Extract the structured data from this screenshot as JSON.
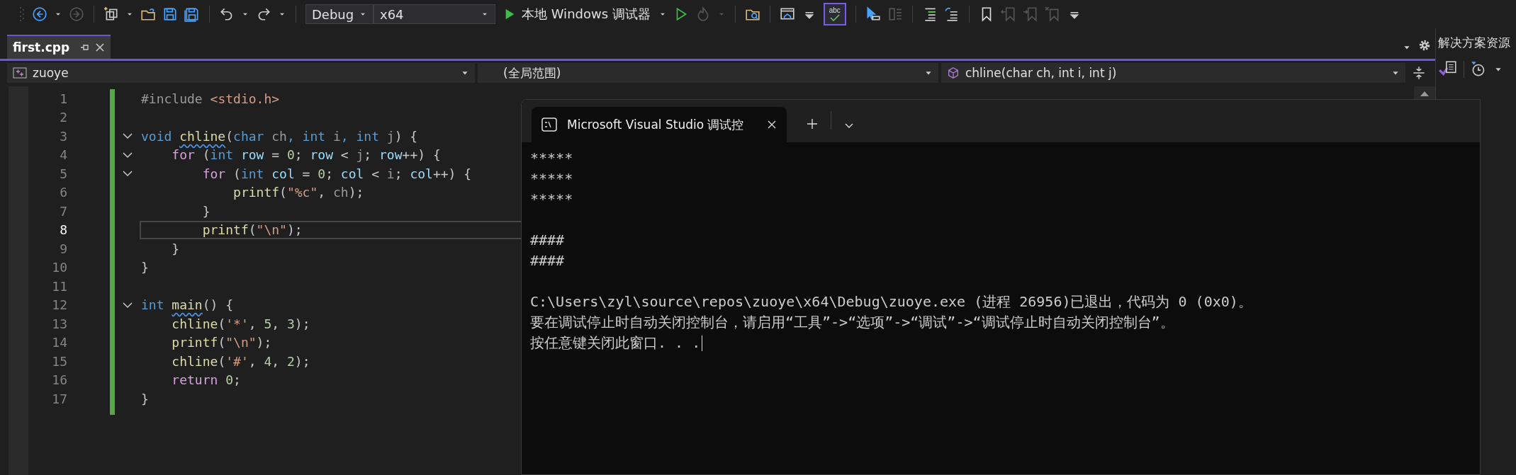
{
  "toolbar": {
    "items": [
      {
        "kind": "back",
        "disabled": false
      },
      {
        "kind": "caret",
        "disabled": false
      },
      {
        "kind": "forward",
        "disabled": true
      },
      {
        "kind": "sep"
      },
      {
        "kind": "new-item",
        "disabled": false
      },
      {
        "kind": "caret",
        "disabled": false
      },
      {
        "kind": "open",
        "disabled": false
      },
      {
        "kind": "save",
        "disabled": false
      },
      {
        "kind": "save-all",
        "disabled": false
      },
      {
        "kind": "sep"
      },
      {
        "kind": "undo",
        "disabled": false
      },
      {
        "kind": "caret",
        "disabled": false
      },
      {
        "kind": "redo",
        "disabled": false
      },
      {
        "kind": "caret",
        "disabled": false
      },
      {
        "kind": "sep"
      },
      {
        "kind": "config",
        "disabled": false,
        "value": "Debug"
      },
      {
        "kind": "platform",
        "disabled": false,
        "value": "x64"
      },
      {
        "kind": "run",
        "disabled": false,
        "label": "本地 Windows 调试器"
      },
      {
        "kind": "caret",
        "disabled": false
      },
      {
        "kind": "run-nodebug",
        "disabled": false
      },
      {
        "kind": "flame",
        "disabled": true
      },
      {
        "kind": "caret",
        "disabled": true
      },
      {
        "kind": "sep"
      },
      {
        "kind": "browse",
        "disabled": false
      },
      {
        "kind": "sep"
      },
      {
        "kind": "home-window",
        "disabled": false
      },
      {
        "kind": "overflow",
        "disabled": false
      },
      {
        "kind": "spell",
        "disabled": false,
        "label": "abc",
        "checked": true
      },
      {
        "kind": "sep"
      },
      {
        "kind": "pointer",
        "disabled": false
      },
      {
        "kind": "panes",
        "disabled": true
      },
      {
        "kind": "sep"
      },
      {
        "kind": "indent",
        "disabled": false
      },
      {
        "kind": "unindent",
        "disabled": false
      },
      {
        "kind": "sep"
      },
      {
        "kind": "bookmark",
        "disabled": false
      },
      {
        "kind": "bookmark-prev",
        "disabled": true
      },
      {
        "kind": "bookmark-next",
        "disabled": true
      },
      {
        "kind": "bookmark-clear",
        "disabled": true
      },
      {
        "kind": "overflow",
        "disabled": false
      }
    ]
  },
  "document_tab": {
    "label": "first.cpp",
    "selected": true
  },
  "nav_bar": {
    "project": "zuoye",
    "scope": "(全局范围)",
    "member": "chline(char ch, int i, int j)"
  },
  "editor": {
    "lines": [
      {
        "number": "1",
        "fold": false,
        "current": false,
        "tokens": [
          {
            "text": "#include",
            "kind": "pp"
          },
          {
            "text": " <stdio.h>",
            "kind": "inc"
          }
        ]
      },
      {
        "number": "2",
        "fold": false,
        "current": false
      },
      {
        "number": "3",
        "fold": true,
        "current": false,
        "tokens": [
          {
            "text": "void ",
            "kind": "kw"
          },
          {
            "text": "chline",
            "kind": "fn_warn"
          },
          {
            "text": "(",
            "kind": "p"
          },
          {
            "text": "char ",
            "kind": "kw"
          },
          {
            "text": "ch",
            "kind": "param"
          },
          {
            "text": ", int ",
            "kind": "kw"
          },
          {
            "text": "i",
            "kind": "param"
          },
          {
            "text": ", int ",
            "kind": "kw"
          },
          {
            "text": "j",
            "kind": "param"
          },
          {
            "text": ") {",
            "kind": "p"
          }
        ]
      },
      {
        "number": "4",
        "fold": true,
        "current": false,
        "tokens": [
          {
            "text": "    for",
            "kind": "ctl"
          },
          {
            "text": " (",
            "kind": "p"
          },
          {
            "text": "int ",
            "kind": "kw"
          },
          {
            "text": "row",
            "kind": "var"
          },
          {
            "text": " = ",
            "kind": "p"
          },
          {
            "text": "0",
            "kind": "num"
          },
          {
            "text": "; ",
            "kind": "p"
          },
          {
            "text": "row",
            "kind": "var"
          },
          {
            "text": " < ",
            "kind": "p"
          },
          {
            "text": "j",
            "kind": "param"
          },
          {
            "text": "; ",
            "kind": "p"
          },
          {
            "text": "row",
            "kind": "var"
          },
          {
            "text": "++) {",
            "kind": "p"
          }
        ]
      },
      {
        "number": "5",
        "fold": true,
        "current": false,
        "tokens": [
          {
            "text": "        for",
            "kind": "ctl"
          },
          {
            "text": " (",
            "kind": "p"
          },
          {
            "text": "int ",
            "kind": "kw"
          },
          {
            "text": "col",
            "kind": "var"
          },
          {
            "text": " = ",
            "kind": "p"
          },
          {
            "text": "0",
            "kind": "num"
          },
          {
            "text": "; ",
            "kind": "p"
          },
          {
            "text": "col",
            "kind": "var"
          },
          {
            "text": " < ",
            "kind": "p"
          },
          {
            "text": "i",
            "kind": "param"
          },
          {
            "text": "; ",
            "kind": "p"
          },
          {
            "text": "col",
            "kind": "var"
          },
          {
            "text": "++) {",
            "kind": "p"
          }
        ]
      },
      {
        "number": "6",
        "fold": false,
        "current": false,
        "tokens": [
          {
            "text": "            printf",
            "kind": "fn"
          },
          {
            "text": "(",
            "kind": "p"
          },
          {
            "text": "\"%c\"",
            "kind": "str"
          },
          {
            "text": ", ",
            "kind": "p"
          },
          {
            "text": "ch",
            "kind": "param"
          },
          {
            "text": ");",
            "kind": "p"
          }
        ]
      },
      {
        "number": "7",
        "fold": false,
        "current": false,
        "tokens": [
          {
            "text": "        }",
            "kind": "p"
          }
        ]
      },
      {
        "number": "8",
        "fold": false,
        "current": true,
        "tokens": [
          {
            "text": "        printf",
            "kind": "fn"
          },
          {
            "text": "(",
            "kind": "p"
          },
          {
            "text": "\"\\n\"",
            "kind": "str"
          },
          {
            "text": ");",
            "kind": "p"
          }
        ]
      },
      {
        "number": "9",
        "fold": false,
        "current": false,
        "tokens": [
          {
            "text": "    }",
            "kind": "p"
          }
        ]
      },
      {
        "number": "10",
        "fold": false,
        "current": false,
        "tokens": [
          {
            "text": "}",
            "kind": "p"
          }
        ]
      },
      {
        "number": "11",
        "fold": false,
        "current": false
      },
      {
        "number": "12",
        "fold": true,
        "current": false,
        "tokens": [
          {
            "text": "int ",
            "kind": "kw"
          },
          {
            "text": "main",
            "kind": "fn_warn"
          },
          {
            "text": "() {",
            "kind": "p"
          }
        ]
      },
      {
        "number": "13",
        "fold": false,
        "current": false,
        "tokens": [
          {
            "text": "    chline",
            "kind": "fn"
          },
          {
            "text": "(",
            "kind": "p"
          },
          {
            "text": "'*'",
            "kind": "str"
          },
          {
            "text": ", ",
            "kind": "p"
          },
          {
            "text": "5",
            "kind": "num"
          },
          {
            "text": ", ",
            "kind": "p"
          },
          {
            "text": "3",
            "kind": "num"
          },
          {
            "text": ");",
            "kind": "p"
          }
        ]
      },
      {
        "number": "14",
        "fold": false,
        "current": false,
        "tokens": [
          {
            "text": "    printf",
            "kind": "fn"
          },
          {
            "text": "(",
            "kind": "p"
          },
          {
            "text": "\"\\n\"",
            "kind": "str"
          },
          {
            "text": ");",
            "kind": "p"
          }
        ]
      },
      {
        "number": "15",
        "fold": false,
        "current": false,
        "tokens": [
          {
            "text": "    chline",
            "kind": "fn"
          },
          {
            "text": "(",
            "kind": "p"
          },
          {
            "text": "'#'",
            "kind": "str"
          },
          {
            "text": ", ",
            "kind": "p"
          },
          {
            "text": "4",
            "kind": "num"
          },
          {
            "text": ", ",
            "kind": "p"
          },
          {
            "text": "2",
            "kind": "num"
          },
          {
            "text": ");",
            "kind": "p"
          }
        ]
      },
      {
        "number": "16",
        "fold": false,
        "current": false,
        "tokens": [
          {
            "text": "    return ",
            "kind": "ctl"
          },
          {
            "text": "0",
            "kind": "num"
          },
          {
            "text": ";",
            "kind": "p"
          }
        ]
      },
      {
        "number": "17",
        "fold": false,
        "current": false,
        "tokens": [
          {
            "text": "}",
            "kind": "p"
          }
        ]
      }
    ]
  },
  "solution_explorer": {
    "title": "解决方案资源"
  },
  "console": {
    "tab_title": "Microsoft Visual Studio 调试控",
    "blocks": [
      [
        "*****",
        "*****",
        "*****"
      ],
      [
        "####",
        "####"
      ],
      [
        "C:\\Users\\zyl\\source\\repos\\zuoye\\x64\\Debug\\zuoye.exe (进程 26956)已退出，代码为 0 (0x0)。",
        "要在调试停止时自动关闭控制台，请启用“工具”->“选项”->“调试”->“调试停止时自动关闭控制台”。",
        "按任意键关闭此窗口. . ."
      ]
    ]
  }
}
